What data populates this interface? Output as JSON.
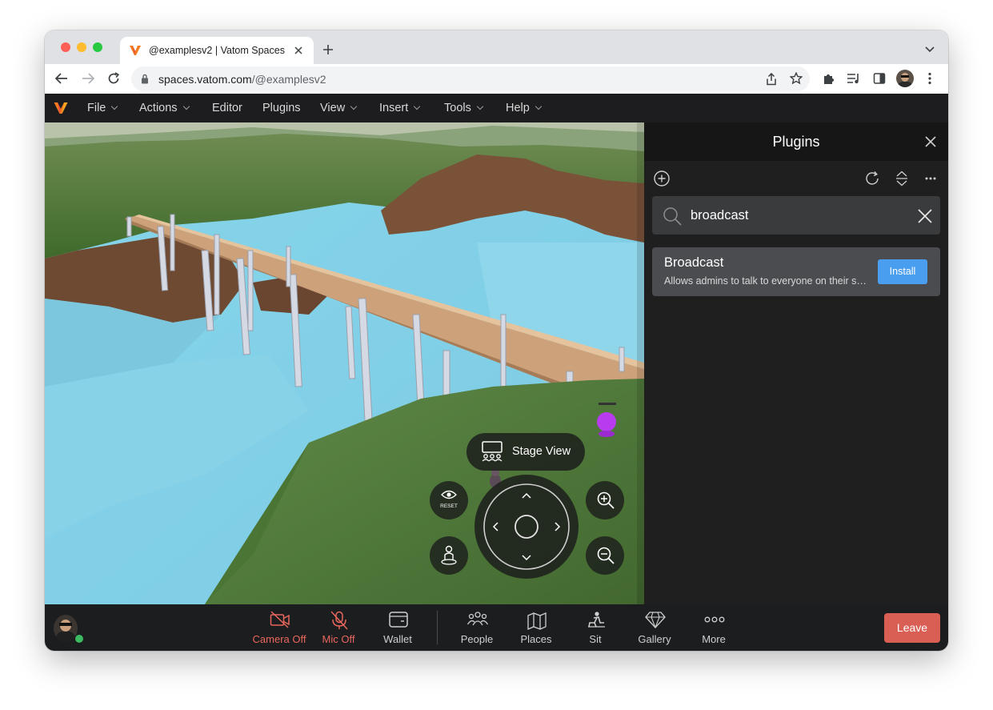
{
  "browser": {
    "tab_title": "@examplesv2 | Vatom Spaces",
    "url_host": "spaces.vatom.com",
    "url_path": "/@examplesv2"
  },
  "menu": {
    "items": [
      {
        "label": "File",
        "has_chevron": true
      },
      {
        "label": "Actions",
        "has_chevron": true
      },
      {
        "label": "Editor",
        "has_chevron": false
      },
      {
        "label": "Plugins",
        "has_chevron": false
      },
      {
        "label": "View",
        "has_chevron": true
      },
      {
        "label": "Insert",
        "has_chevron": true
      },
      {
        "label": "Tools",
        "has_chevron": true
      },
      {
        "label": "Help",
        "has_chevron": true
      }
    ]
  },
  "scene": {
    "stage_view_label": "Stage View",
    "reset_label": "RESET"
  },
  "plugins_panel": {
    "title": "Plugins",
    "search_value": "broadcast",
    "results": [
      {
        "title": "Broadcast",
        "description": "Allows admins to talk to everyone on their space.",
        "action_label": "Install"
      }
    ]
  },
  "bottom_bar": {
    "buttons": [
      {
        "label": "Camera Off",
        "icon": "camera-off-icon",
        "state": "off"
      },
      {
        "label": "Mic Off",
        "icon": "mic-off-icon",
        "state": "off"
      },
      {
        "label": "Wallet",
        "icon": "wallet-icon"
      },
      {
        "label": "People",
        "icon": "people-icon"
      },
      {
        "label": "Places",
        "icon": "map-icon"
      },
      {
        "label": "Sit",
        "icon": "sit-icon"
      },
      {
        "label": "Gallery",
        "icon": "diamond-icon"
      },
      {
        "label": "More",
        "icon": "more-icon"
      }
    ],
    "leave_label": "Leave"
  },
  "colors": {
    "accent_blue": "#4a9ef0",
    "danger_red": "#d95f55",
    "off_red": "#e8675d",
    "online_green": "#3dbb63",
    "panel_bg": "#1f1f1f",
    "menubar_bg": "#1d1d1f"
  }
}
